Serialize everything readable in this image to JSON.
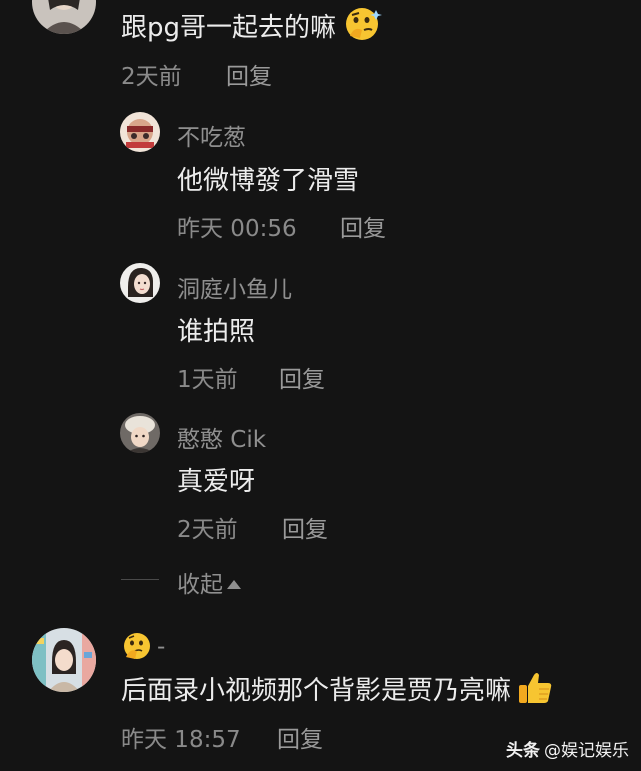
{
  "comments": [
    {
      "avatar": "woman-avatar",
      "text": "跟pg哥一起去的嘛",
      "emoji": "thinking-face-emoji",
      "time": "2天前",
      "reply_label": "回复"
    },
    {
      "name": "不吃葱",
      "avatar": "cartoon-avatar",
      "text": "他微博發了滑雪",
      "time": "昨天 00:56",
      "reply_label": "回复"
    },
    {
      "name": "洞庭小鱼儿",
      "avatar": "woman-avatar",
      "text": "谁拍照",
      "time": "1天前",
      "reply_label": "回复"
    },
    {
      "name": "憨憨 Cik",
      "avatar": "girl-hat-avatar",
      "text": "真爱呀",
      "time": "2天前",
      "reply_label": "回复"
    },
    {
      "name": "-",
      "name_emoji": "thinking-face-emoji",
      "avatar": "girl-shop-avatar",
      "text": "后面录小视频那个背影是贾乃亮嘛",
      "emoji": "thumbs-up-emoji",
      "time": "昨天 18:57",
      "reply_label": "回复"
    }
  ],
  "collapse_label": "收起",
  "watermark": {
    "brand": "头条",
    "handle": "@娱记娱乐"
  },
  "colors": {
    "background": "#141414",
    "text": "#ececec",
    "secondary": "#8a8a8a"
  }
}
